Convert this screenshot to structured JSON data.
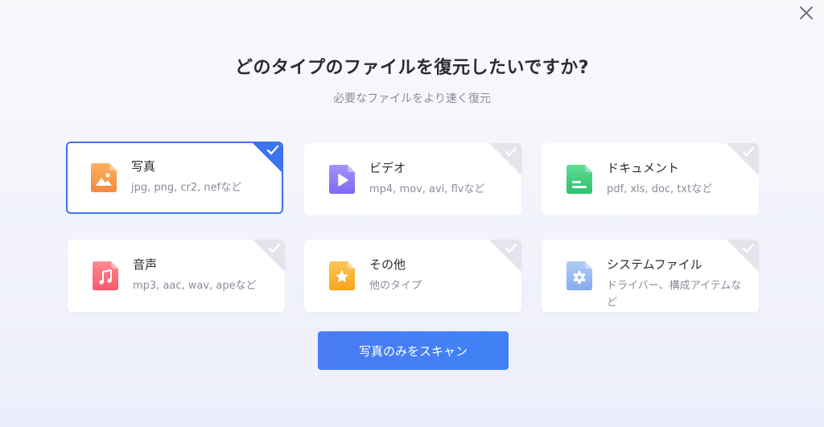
{
  "dialog": {
    "title": "どのタイプのファイルを復元したいですか?",
    "subtitle": "必要なファイルをより速く復元",
    "close_icon": "close-icon"
  },
  "file_types": [
    {
      "name": "写真",
      "description": "jpg, png, cr2, nefなど",
      "icon": "image-file-icon",
      "color": "#f99b4a",
      "selected": true
    },
    {
      "name": "ビデオ",
      "description": "mp4, mov, avi, flvなど",
      "icon": "video-file-icon",
      "color": "#8e7cf7",
      "selected": false
    },
    {
      "name": "ドキュメント",
      "description": "pdf, xls, doc, txtなど",
      "icon": "document-file-icon",
      "color": "#3ecf7d",
      "selected": false
    },
    {
      "name": "音声",
      "description": "mp3, aac, wav, apeなど",
      "icon": "audio-file-icon",
      "color": "#fa6a78",
      "selected": false
    },
    {
      "name": "その他",
      "description": "他のタイプ",
      "icon": "other-file-icon",
      "color": "#fbb534",
      "selected": false
    },
    {
      "name": "システムファイル",
      "description": "ドライバー、構成アイテムなど",
      "icon": "system-file-icon",
      "color": "#8fb6f2",
      "selected": false
    }
  ],
  "scan_button": {
    "label": "写真のみをスキャン"
  },
  "colors": {
    "accent": "#3d74ee",
    "unchecked_corner": "#e3e4ec",
    "title": "#2b2b33",
    "muted_text": "#8a8d99"
  }
}
